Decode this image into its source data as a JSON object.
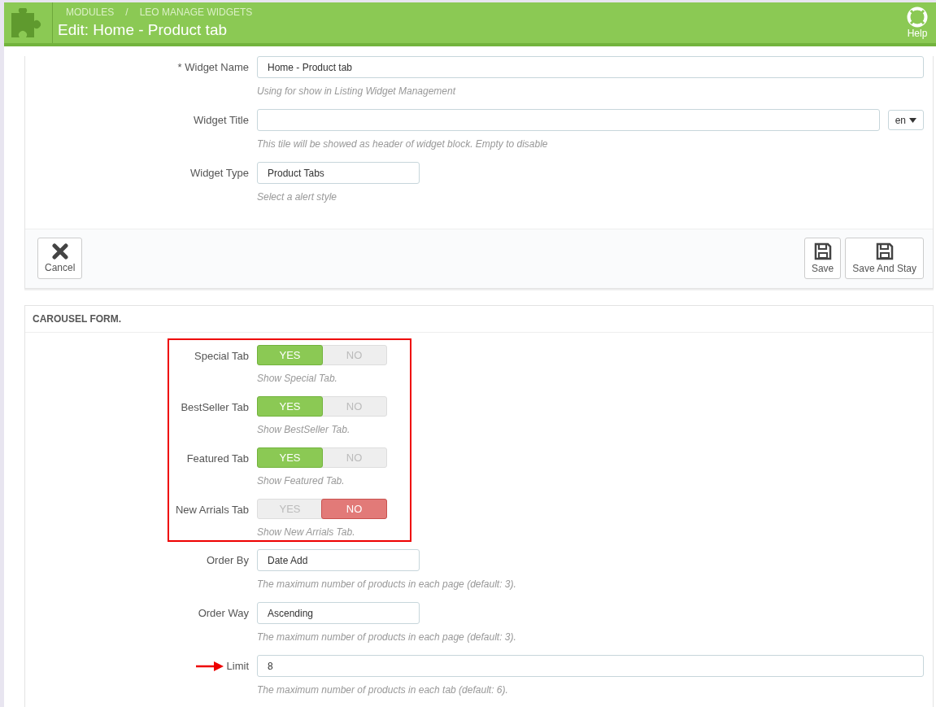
{
  "header": {
    "breadcrumb": [
      "MODULES",
      "/",
      "LEO MANAGE WIDGETS"
    ],
    "title": "Edit: Home - Product tab",
    "help": "Help"
  },
  "widget_form": {
    "fields": [
      {
        "kind": "wide_input",
        "label": "* Widget Name",
        "value": "Home - Product tab",
        "help": "Using for show in Listing Widget Management"
      },
      {
        "kind": "wide_input",
        "label": "Widget Title",
        "language": "en",
        "help": "This tile will be showed as header of widget block. Empty to disable"
      },
      {
        "kind": "narrow_input",
        "label": "Widget Type",
        "value": "Product Tabs",
        "help": "Select a alert style"
      }
    ],
    "buttons": [
      {
        "kind": "cancel",
        "label": "Cancel"
      },
      {
        "kind": "save",
        "label": "Save"
      },
      {
        "kind": "save",
        "label": "Save And Stay"
      }
    ]
  },
  "carousel_form": {
    "title": "CAROUSEL FORM.",
    "fields": [
      {
        "kind": "toggle",
        "label": "Special Tab",
        "yes": "YES",
        "no": "NO",
        "on": true,
        "highlighted": true,
        "help": "Show Special Tab."
      },
      {
        "kind": "toggle",
        "label": "BestSeller Tab",
        "yes": "YES",
        "no": "NO",
        "on": true,
        "highlighted": true,
        "help": "Show BestSeller Tab."
      },
      {
        "kind": "toggle",
        "label": "Featured Tab",
        "yes": "YES",
        "no": "NO",
        "on": true,
        "highlighted": true,
        "help": "Show Featured Tab."
      },
      {
        "kind": "toggle",
        "label": "New Arrials Tab",
        "yes": "YES",
        "no": "NO",
        "on": false,
        "highlighted": true,
        "help": "Show New Arrials Tab."
      },
      {
        "kind": "narrow_input",
        "label": "Order By",
        "value": "Date Add",
        "highlighted": false,
        "help": "The maximum number of products in each page (default: 3)."
      },
      {
        "kind": "narrow_input",
        "label": "Order Way",
        "value": "Ascending",
        "highlighted": false,
        "help": "The maximum number of products in each page (default: 3)."
      },
      {
        "kind": "wide_input",
        "label": "Limit",
        "value": "8",
        "highlighted": false,
        "arrow": true,
        "help": "The maximum number of products in each tab (default: 6)."
      }
    ]
  }
}
